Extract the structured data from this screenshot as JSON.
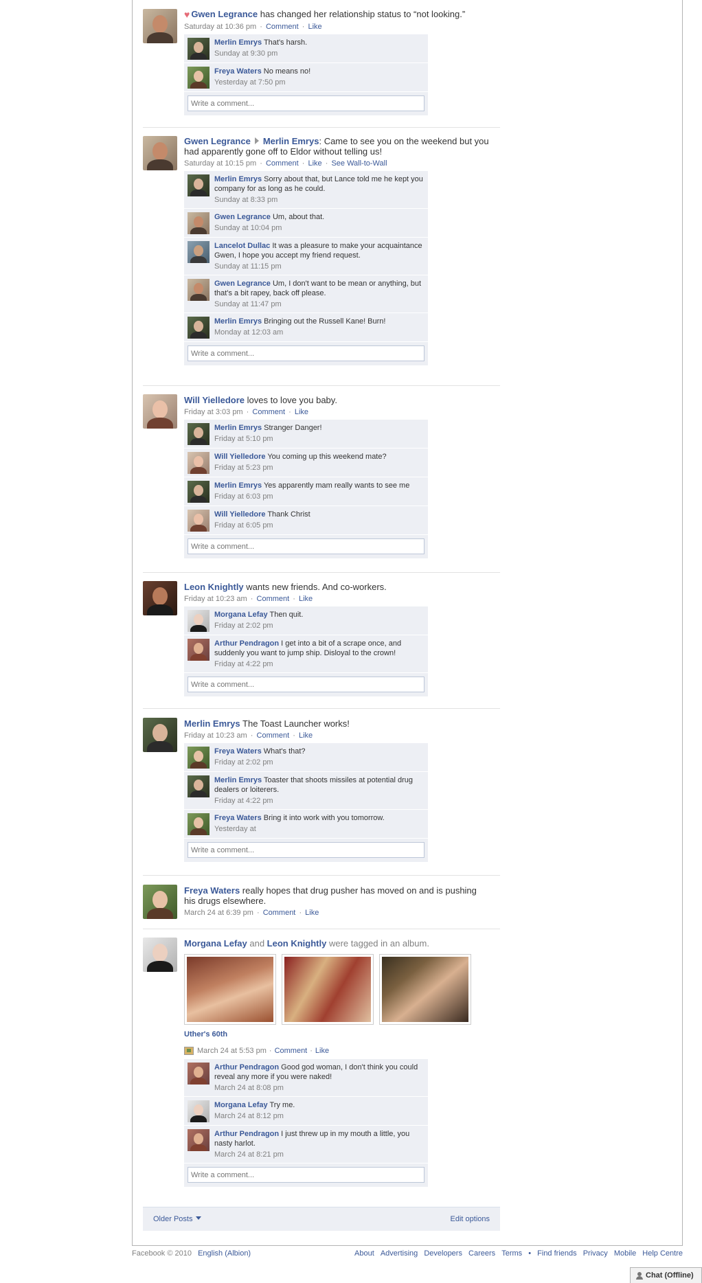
{
  "write_placeholder": "Write a comment...",
  "actions": {
    "comment": "Comment",
    "like": "Like",
    "see_wall": "See Wall-to-Wall",
    "sep": "·"
  },
  "stories": [
    {
      "actor": "Gwen Legrance",
      "text": " has changed her relationship status to “not looking.”",
      "time": "Saturday at 10:36 pm",
      "comments": [
        {
          "author": "Merlin Emrys",
          "text": " That's harsh.",
          "time": "Sunday at 9:30 pm"
        },
        {
          "author": "Freya Waters",
          "text": " No means no!",
          "time": "Yesterday at 7:50 pm"
        }
      ]
    },
    {
      "actor": "Gwen Legrance",
      "target": "Merlin Emrys",
      "text": ":  Came to see you on the weekend but you had apparently gone off to Eldor without telling us!",
      "time": "Saturday at 10:15 pm",
      "comments": [
        {
          "author": "Merlin Emrys",
          "text": " Sorry about that, but Lance told me he kept you company for as long as he could.",
          "time": "Sunday at 8:33 pm"
        },
        {
          "author": "Gwen Legrance",
          "text": " Um, about that.",
          "time": "Sunday at 10:04 pm"
        },
        {
          "author": "Lancelot Dullac",
          "text": " It was a pleasure to make your acquaintance Gwen, I hope you accept my friend request.",
          "time": "Sunday at 11:15 pm"
        },
        {
          "author": "Gwen Legrance",
          "text": " Um, I don't want to be mean or anything, but that's a bit rapey, back off please.",
          "time": "Sunday at 11:47 pm"
        },
        {
          "author": "Merlin Emrys",
          "text": " Bringing out the Russell Kane! Burn!",
          "time": "Monday at 12:03 am"
        }
      ]
    },
    {
      "actor": "Will Yielledore",
      "text": " loves to love you baby.",
      "time": "Friday at 3:03 pm",
      "comments": [
        {
          "author": "Merlin Emrys",
          "text": " Stranger Danger!",
          "time": "Friday at 5:10 pm"
        },
        {
          "author": "Will Yielledore",
          "text": " You coming up this weekend mate?",
          "time": "Friday at 5:23 pm"
        },
        {
          "author": "Merlin Emrys",
          "text": " Yes apparently mam really wants to see me",
          "time": "Friday at 6:03 pm"
        },
        {
          "author": "Will Yielledore",
          "text": " Thank Christ",
          "time": "Friday at 6:05 pm"
        }
      ]
    },
    {
      "actor": "Leon Knightly",
      "text": " wants new friends. And co-workers.",
      "time": "Friday at 10:23 am",
      "comments": [
        {
          "author": "Morgana Lefay",
          "text": " Then quit.",
          "time": "Friday at 2:02 pm"
        },
        {
          "author": "Arthur Pendragon",
          "text": " I get into a bit of a scrape once, and suddenly you want to jump ship. Disloyal to the crown!",
          "time": "Friday at 4:22 pm"
        }
      ]
    },
    {
      "actor": "Merlin Emrys",
      "text": " The Toast Launcher works!",
      "time": "Friday at 10:23 am",
      "comments": [
        {
          "author": "Freya Waters",
          "text": " What's that?",
          "time": "Friday at 2:02 pm"
        },
        {
          "author": "Merlin Emrys",
          "text": " Toaster that shoots missiles at potential drug dealers or loiterers.",
          "time": "Friday at 4:22 pm"
        },
        {
          "author": "Freya Waters",
          "text": " Bring it into work with you tomorrow.",
          "time": "Yesterday at"
        }
      ]
    },
    {
      "actor": "Freya Waters",
      "text": " really hopes that drug pusher has moved on and is pushing his drugs elsewhere.",
      "time": "March 24 at 6:39 pm"
    },
    {
      "actor": "Morgana Lefay",
      "joiner": " and ",
      "actor2": "Leon Knightly",
      "text": " were tagged in an album.",
      "album_title": "Uther's 60th",
      "time": "March 24 at 5:53 pm",
      "comments": [
        {
          "author": "Arthur Pendragon",
          "text": " Good god woman, I don't think you could reveal any more if you were naked!",
          "time": "March 24 at 8:08 pm"
        },
        {
          "author": "Morgana Lefay",
          "text": " Try me.",
          "time": "March 24 at 8:12 pm"
        },
        {
          "author": "Arthur Pendragon",
          "text": " I just threw up in my mouth a little, you nasty harlot.",
          "time": "March 24 at 8:21 pm"
        }
      ]
    }
  ],
  "older_posts": "Older Posts",
  "edit_options": "Edit options",
  "footer": {
    "copyright": "Facebook © 2010",
    "language": "English (Albion)",
    "links": [
      "About",
      "Advertising",
      "Developers",
      "Careers",
      "Terms",
      "•",
      "Find friends",
      "Privacy",
      "Mobile",
      "Help Centre"
    ]
  },
  "chat": "Chat (Offline)"
}
